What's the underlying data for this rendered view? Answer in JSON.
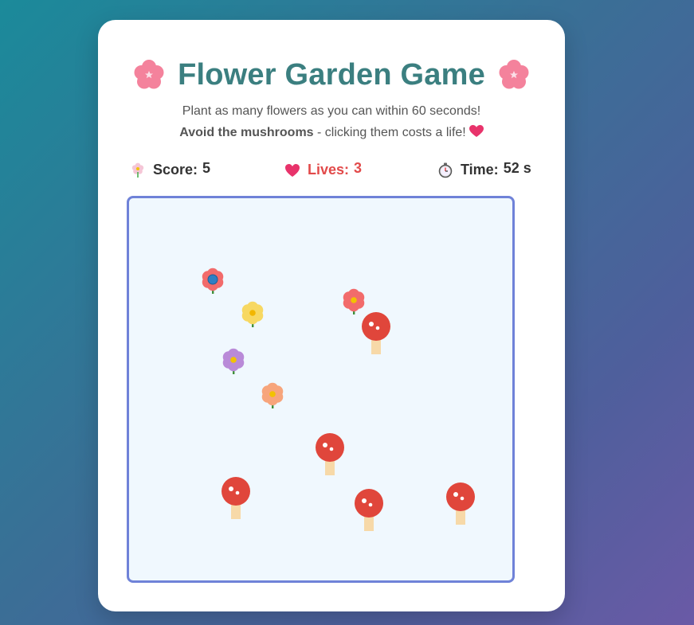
{
  "game": {
    "title": "Flower Garden Game",
    "instructions_line1": "Plant as many flowers as you can within 60 seconds!",
    "instructions_bold": "Avoid the mushrooms",
    "instructions_rest": " - clicking them costs a life!"
  },
  "stats": {
    "score_label": "Score:",
    "score_value": "5",
    "lives_label": "Lives:",
    "lives_value": "3",
    "time_label": "Time:",
    "time_value": "52 s"
  },
  "garden": {
    "flowers": [
      {
        "color": "#f26b6b",
        "center": "#2e7fc4"
      },
      {
        "color": "#f7d862",
        "center": "#f2b600"
      },
      {
        "color": "#f26b6b",
        "center": "#f2c200"
      },
      {
        "color": "#b98ad8",
        "center": "#f2c200"
      },
      {
        "color": "#f7a57c",
        "center": "#f2c200"
      }
    ],
    "mushrooms": [
      {
        "cap": "#e0463b"
      },
      {
        "cap": "#e0463b"
      },
      {
        "cap": "#e0463b"
      },
      {
        "cap": "#e0463b"
      },
      {
        "cap": "#e0463b"
      }
    ]
  }
}
